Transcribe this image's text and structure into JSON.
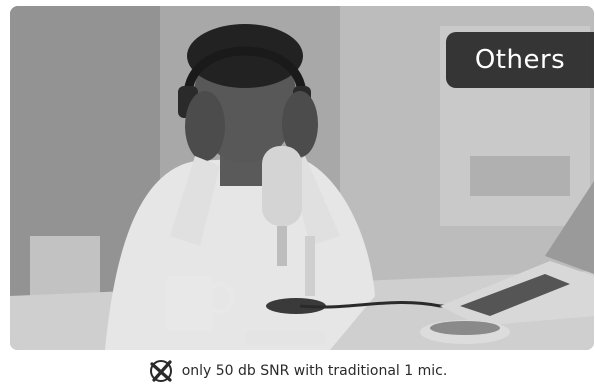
{
  "badge": {
    "label": "Others"
  },
  "caption": {
    "text": "only 50 db SNR with traditional 1 mic."
  },
  "icons": {
    "photo": "podcaster-photo",
    "status": "cross-mark-icon"
  },
  "colors": {
    "badge_bg": "#282828",
    "text": "#2a2a2a"
  }
}
